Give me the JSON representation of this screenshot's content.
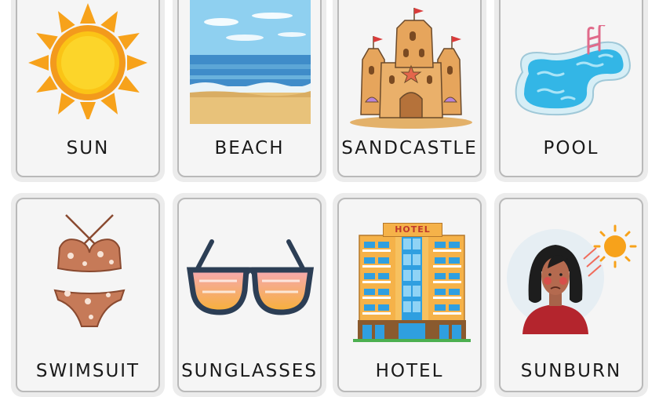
{
  "cards": [
    {
      "label": "SUN",
      "icon": "sun-icon"
    },
    {
      "label": "BEACH",
      "icon": "beach-icon"
    },
    {
      "label": "SANDCASTLE",
      "icon": "sandcastle-icon"
    },
    {
      "label": "POOL",
      "icon": "pool-icon"
    },
    {
      "label": "SWIMSUIT",
      "icon": "swimsuit-icon"
    },
    {
      "label": "SUNGLASSES",
      "icon": "sunglasses-icon"
    },
    {
      "label": "HOTEL",
      "icon": "hotel-icon"
    },
    {
      "label": "SUNBURN",
      "icon": "sunburn-icon"
    }
  ],
  "hotel_sign": "HOTEL",
  "colors": {
    "card_background": "#f5f5f5",
    "card_border": "#b9b9b9",
    "sun": "#f7a21b",
    "sea": "#4f9bd0",
    "sand": "#e8c27a",
    "pool_water": "#33b6e6",
    "swimsuit": "#c67a58",
    "lens_top": "#f6a9b2",
    "lens_bottom": "#f7b036",
    "hotel_wall": "#f5b249",
    "hotel_glass": "#2f9fe0"
  }
}
